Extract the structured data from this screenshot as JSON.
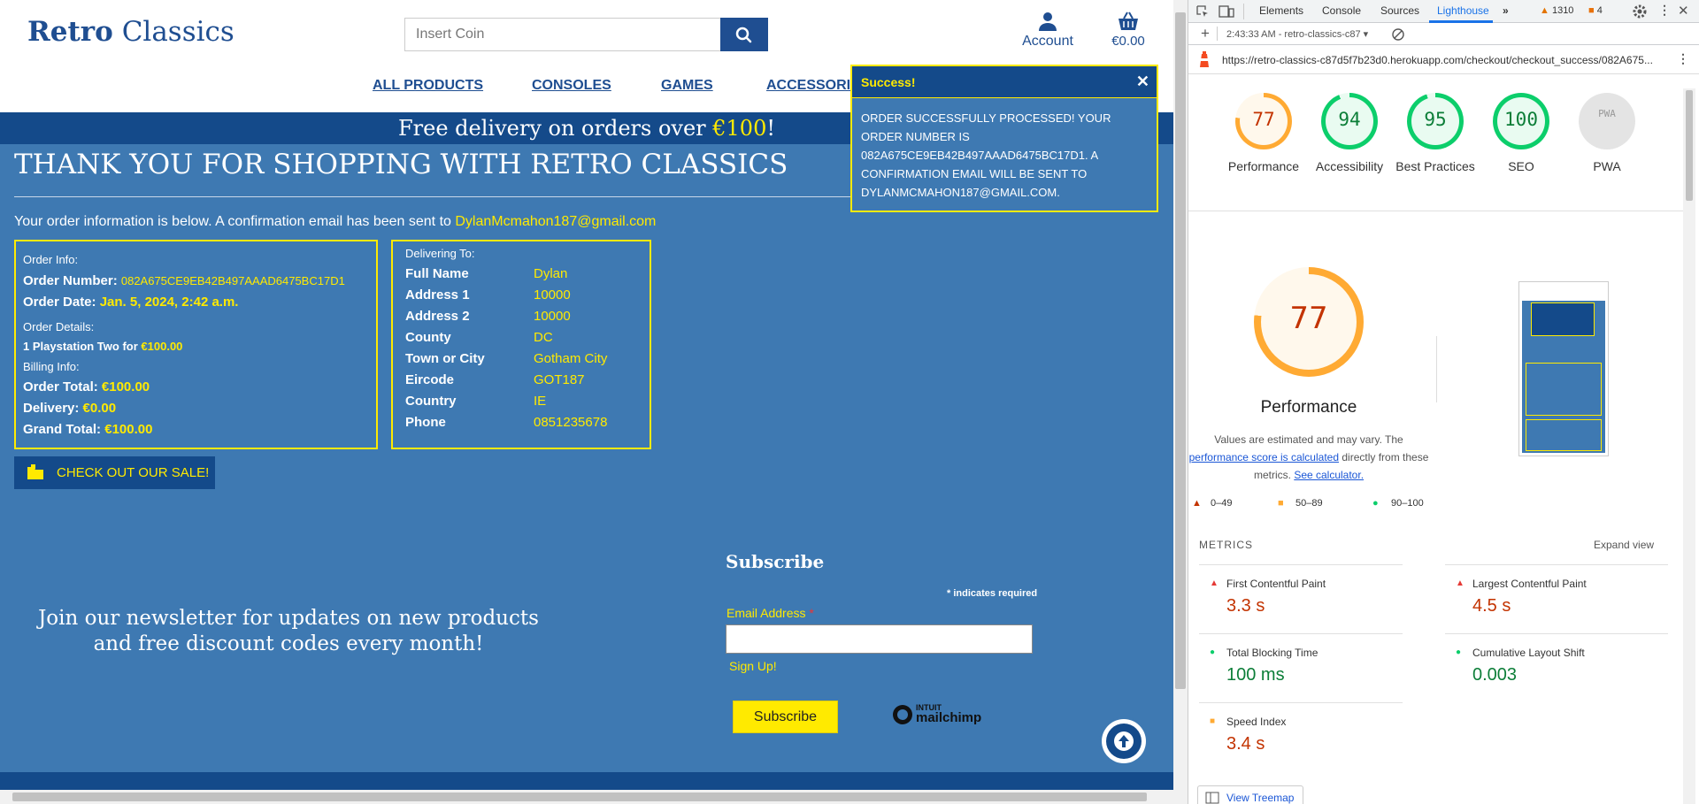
{
  "site": {
    "logo": {
      "bold": "Retro",
      "rest": "Classics"
    },
    "search": {
      "placeholder": "Insert Coin"
    },
    "account_label": "Account",
    "cart_total": "€0.00",
    "nav": [
      "ALL PRODUCTS",
      "CONSOLES",
      "GAMES",
      "ACCESSORIE"
    ],
    "banner": {
      "text": "Free delivery on orders over ",
      "amount": "€100",
      "suffix": "!"
    },
    "thank_you": "THANK YOU FOR SHOPPING WITH RETRO CLASSICS",
    "order_intro": "Your order information is below. A confirmation email has been sent to",
    "email": "DylanMcmahon187@gmail.com",
    "order": {
      "info_label": "Order Info:",
      "number_label": "Order Number:",
      "number": "082A675CE9EB42B497AAAD6475BC17D1",
      "date_label": "Order Date:",
      "date": "Jan. 5, 2024, 2:42 a.m.",
      "details_label": "Order Details:",
      "item": "1 Playstation Two for",
      "item_price": "€100.00",
      "billing_label": "Billing Info:",
      "total_label": "Order Total:",
      "total": "€100.00",
      "delivery_label": "Delivery:",
      "delivery": "€0.00",
      "grand_label": "Grand Total:",
      "grand": "€100.00"
    },
    "delivery": {
      "heading": "Delivering To:",
      "rows": [
        {
          "label": "Full Name",
          "value": "Dylan"
        },
        {
          "label": "Address 1",
          "value": "10000"
        },
        {
          "label": "Address 2",
          "value": "10000"
        },
        {
          "label": "County",
          "value": "DC"
        },
        {
          "label": "Town or City",
          "value": "Gotham City"
        },
        {
          "label": "Eircode",
          "value": "GOT187"
        },
        {
          "label": "Country",
          "value": "IE"
        },
        {
          "label": "Phone",
          "value": "0851235678"
        }
      ]
    },
    "sale_button": "CHECK OUT OUR SALE!",
    "newsletter_text": "Join our newsletter for updates on new products and free discount codes every month!",
    "subscribe": {
      "heading": "Subscribe",
      "required_note": "indicates required",
      "email_label": "Email Address",
      "signup_link": "Sign Up!",
      "button": "Subscribe",
      "brand_top": "INTUIT",
      "brand_bottom": "mailchimp"
    }
  },
  "toast": {
    "title": "Success!",
    "message": "ORDER SUCCESSFULLY PROCESSED! YOUR ORDER NUMBER IS 082A675CE9EB42B497AAAD6475BC17D1. A CONFIRMATION EMAIL WILL BE SENT TO DYLANMCMAHON187@GMAIL.COM."
  },
  "devtools": {
    "tabs": [
      "Elements",
      "Console",
      "Sources",
      "Lighthouse"
    ],
    "active_tab": "Lighthouse",
    "warnings": "1310",
    "errors": "4",
    "report_time": "2:43:33 AM - retro-classics-c87",
    "url": "https://retro-classics-c87d5f7b23d0.herokuapp.com/checkout/checkout_success/082A675...",
    "scores": [
      {
        "label": "Performance",
        "value": "77",
        "percent": 77,
        "status": "average"
      },
      {
        "label": "Accessibility",
        "value": "94",
        "percent": 94,
        "status": "pass"
      },
      {
        "label": "Best Practices",
        "value": "95",
        "percent": 95,
        "status": "pass"
      },
      {
        "label": "SEO",
        "value": "100",
        "percent": 100,
        "status": "pass"
      },
      {
        "label": "PWA",
        "value": "PWA",
        "percent": 0,
        "status": "na"
      }
    ],
    "perf_score": "77",
    "perf_title": "Performance",
    "perf_note": {
      "pre": "Values are estimated and may vary. The",
      "link1": "performance score is calculated",
      "mid": "directly from these metrics.",
      "link2": "See calculator."
    },
    "legend": [
      "0–49",
      "50–89",
      "90–100"
    ],
    "metrics_label": "METRICS",
    "expand_label": "Expand view",
    "metrics": [
      {
        "name": "First Contentful Paint",
        "value": "3.3 s",
        "status": "fail"
      },
      {
        "name": "Largest Contentful Paint",
        "value": "4.5 s",
        "status": "fail"
      },
      {
        "name": "Total Blocking Time",
        "value": "100 ms",
        "status": "pass"
      },
      {
        "name": "Cumulative Layout Shift",
        "value": "0.003",
        "status": "pass"
      },
      {
        "name": "Speed Index",
        "value": "3.4 s",
        "status": "average"
      }
    ],
    "treemap_button": "View Treemap"
  }
}
